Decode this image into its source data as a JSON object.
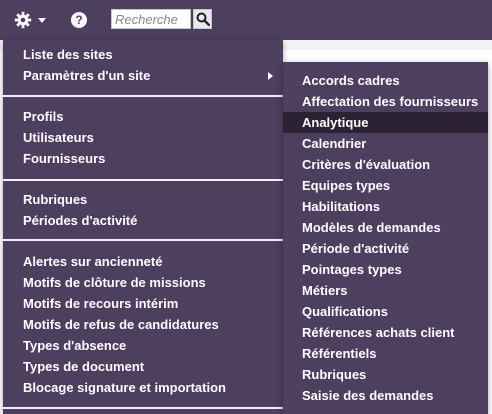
{
  "header": {
    "settings_icon": "gear-icon",
    "help_label": "?",
    "search": {
      "placeholder": "Recherche",
      "value": ""
    },
    "search_icon": "search-icon"
  },
  "menu": {
    "groups": [
      [
        "Liste des sites",
        "Paramètres d'un site"
      ],
      [
        "Profils",
        "Utilisateurs",
        "Fournisseurs"
      ],
      [
        "Rubriques",
        "Périodes d'activité"
      ],
      [
        "Alertes sur ancienneté",
        "Motifs de clôture de missions",
        "Motifs de recours intérim",
        "Motifs de refus de candidatures",
        "Types d'absence",
        "Types de document",
        "Blocage signature et importation"
      ]
    ]
  },
  "submenu": {
    "items": [
      "Accords cadres",
      "Affectation des fournisseurs",
      "Analytique",
      "Calendrier",
      "Critères d'évaluation",
      "Equipes types",
      "Habilitations",
      "Modèles de demandes",
      "Période d'activité",
      "Pointages types",
      "Métiers",
      "Qualifications",
      "Références achats client",
      "Référentiels",
      "Rubriques",
      "Saisie des demandes"
    ],
    "active": "Analytique"
  },
  "colors": {
    "menu_bg": "#4d3f5e",
    "active_bg": "#2b2236",
    "text": "#ffffff"
  }
}
